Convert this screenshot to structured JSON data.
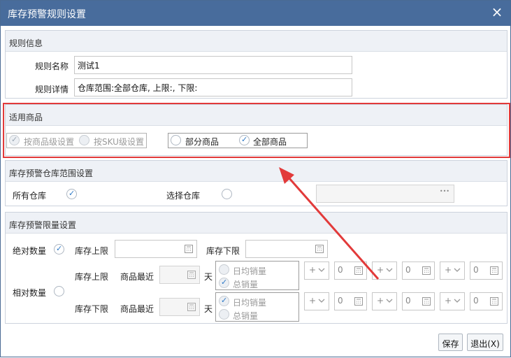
{
  "window": {
    "title": "库存预警规则设置",
    "close_label": "×"
  },
  "rule_info": {
    "section_title": "规则信息",
    "name_label": "规则名称",
    "name_value": "测试1",
    "detail_label": "规则详情",
    "detail_value": "仓库范围:全部仓库, 上限:, 下限:"
  },
  "goods": {
    "section_title": "适用商品",
    "by_goods_level": "按商品级设置",
    "by_sku_level": "按SKU级设置",
    "partial_goods": "部分商品",
    "all_goods": "全部商品"
  },
  "warehouse": {
    "section_title": "库存预警仓库范围设置",
    "all_label": "所有仓库",
    "select_label": "选择仓库",
    "more_label": "•••"
  },
  "limit": {
    "section_title": "库存预警限量设置",
    "absolute_label": "绝对数量",
    "upper_label": "库存上限",
    "lower_label": "库存下限",
    "relative_label": "相对数量",
    "recent_label": "商品最近",
    "day_label": "天",
    "daily_avg_label": "日均销量",
    "total_label": "总销量",
    "op_plus": "+",
    "zero": "0"
  },
  "footer": {
    "save": "保存",
    "exit": "退出(X)"
  },
  "colors": {
    "title_bar": "#486c9c",
    "accent": "#2d79c7",
    "highlight": "#e23a3a"
  }
}
